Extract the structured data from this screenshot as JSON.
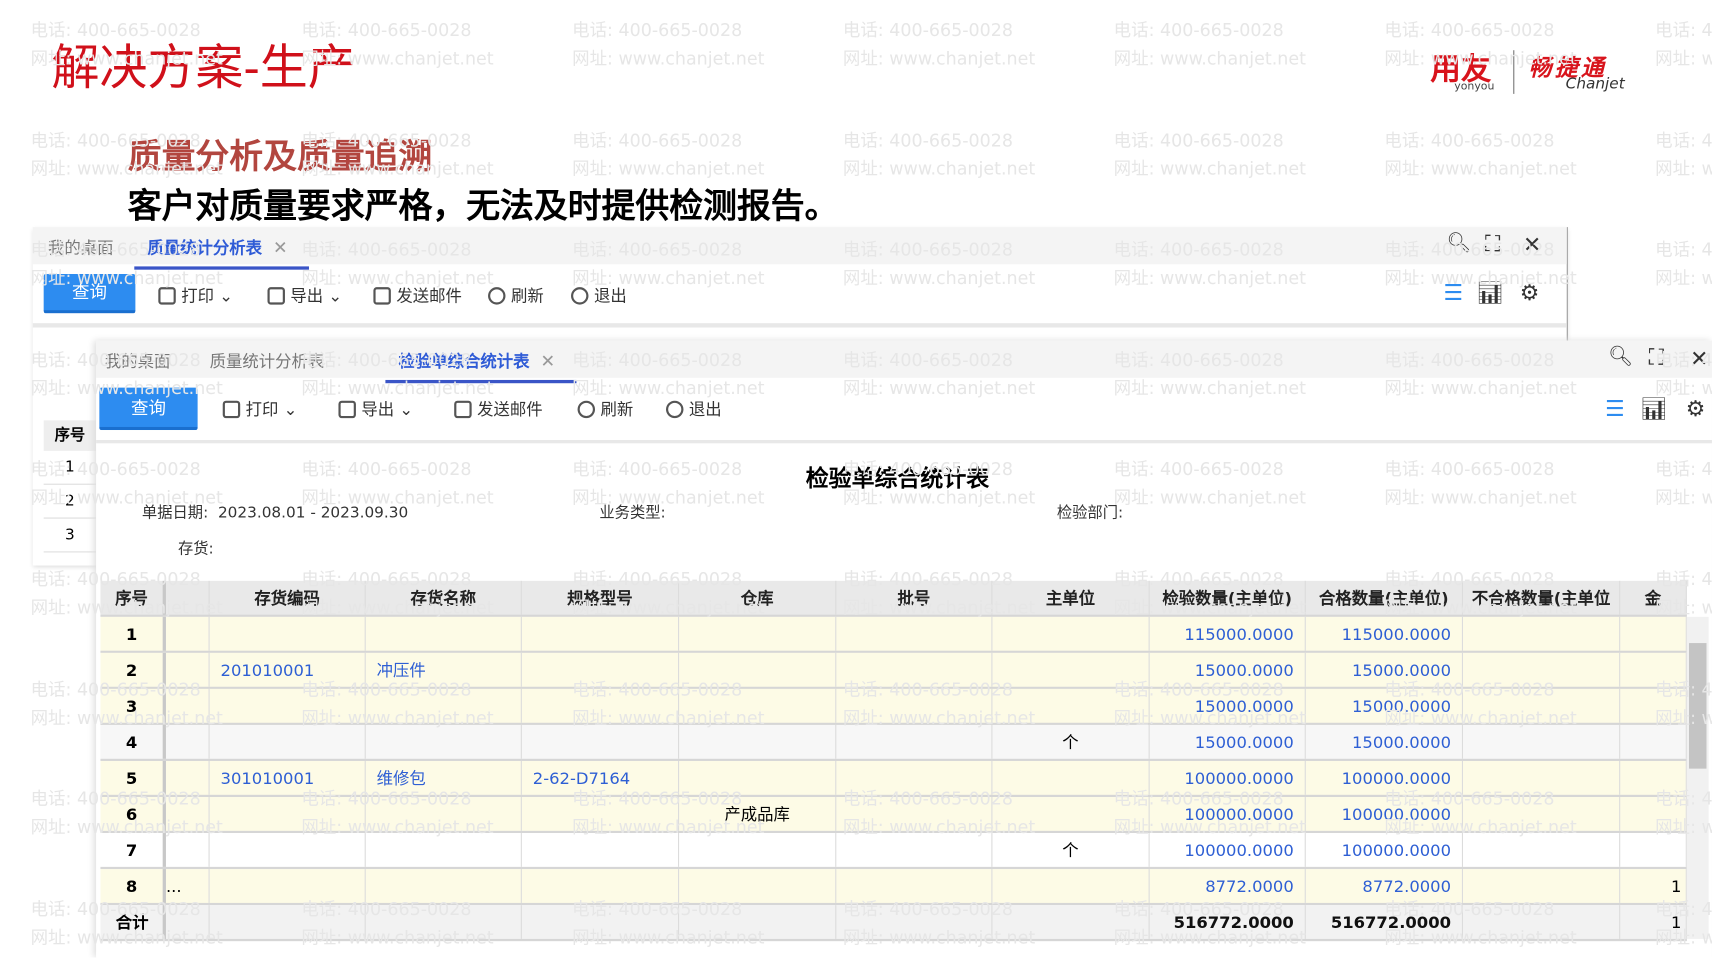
{
  "slide": {
    "title": "解决方案-生产",
    "subtitle": "质量分析及质量追溯",
    "description": "客户对质量要求严格，无法及时提供检测报告。"
  },
  "logo": {
    "yonyou_cn": "用友",
    "yonyou_en": "yonyou",
    "chanjet_cn": "畅捷通",
    "chanjet_en": "Chanjet"
  },
  "watermark": {
    "phone": "电话: 400-665-0028",
    "site": "网址: www.chanjet.net"
  },
  "window1": {
    "tabs": [
      {
        "label": "我的桌面"
      },
      {
        "label": "质量统计分析表"
      }
    ],
    "left_table": {
      "header": "序号",
      "rows": [
        "1",
        "2",
        "3"
      ]
    }
  },
  "window2": {
    "tabs": [
      {
        "label": "我的桌面"
      },
      {
        "label": "质量统计分析表"
      },
      {
        "label": "检验单综合统计表"
      }
    ]
  },
  "toolbar": {
    "query": "查询",
    "print": "打印",
    "export": "导出",
    "email": "发送邮件",
    "refresh": "刷新",
    "exit": "退出"
  },
  "colors": {
    "accent": "#2d8cf0",
    "title_red": "#d0101a",
    "link": "#2e5fd4"
  },
  "report": {
    "title": "检验单综合统计表",
    "filters": {
      "date_label": "单据日期:",
      "date_value": "2023.08.01 - 2023.09.30",
      "biz_type_label": "业务类型:",
      "dept_label": "检验部门:",
      "inventory_label": "存货:"
    },
    "columns": [
      "序号",
      "",
      "存货编码",
      "存货名称",
      "规格型号",
      "仓库",
      "批号",
      "主单位",
      "检验数量(主单位)",
      "合格数量(主单位)",
      "不合格数量(主单位",
      "金"
    ],
    "rows": [
      [
        "1",
        "",
        "",
        "",
        "",
        "",
        "",
        "",
        "115000.0000",
        "115000.0000",
        "",
        ""
      ],
      [
        "2",
        "",
        "201010001",
        "冲压件",
        "",
        "",
        "",
        "",
        "15000.0000",
        "15000.0000",
        "",
        ""
      ],
      [
        "3",
        "",
        "",
        "",
        "",
        "",
        "",
        "",
        "15000.0000",
        "15000.0000",
        "",
        ""
      ],
      [
        "4",
        "",
        "",
        "",
        "",
        "",
        "",
        "个",
        "15000.0000",
        "15000.0000",
        "",
        ""
      ],
      [
        "5",
        "",
        "301010001",
        "维修包",
        "2-62-D7164",
        "",
        "",
        "",
        "100000.0000",
        "100000.0000",
        "",
        ""
      ],
      [
        "6",
        "",
        "",
        "",
        "",
        "产成品库",
        "",
        "",
        "100000.0000",
        "100000.0000",
        "",
        ""
      ],
      [
        "7",
        "",
        "",
        "",
        "",
        "",
        "",
        "个",
        "100000.0000",
        "100000.0000",
        "",
        ""
      ],
      [
        "8",
        "...",
        "",
        "",
        "",
        "",
        "",
        "",
        "8772.0000",
        "8772.0000",
        "",
        "1"
      ]
    ],
    "total": [
      "合计",
      "",
      "",
      "",
      "",
      "",
      "",
      "",
      "516772.0000",
      "516772.0000",
      "",
      "1"
    ]
  }
}
